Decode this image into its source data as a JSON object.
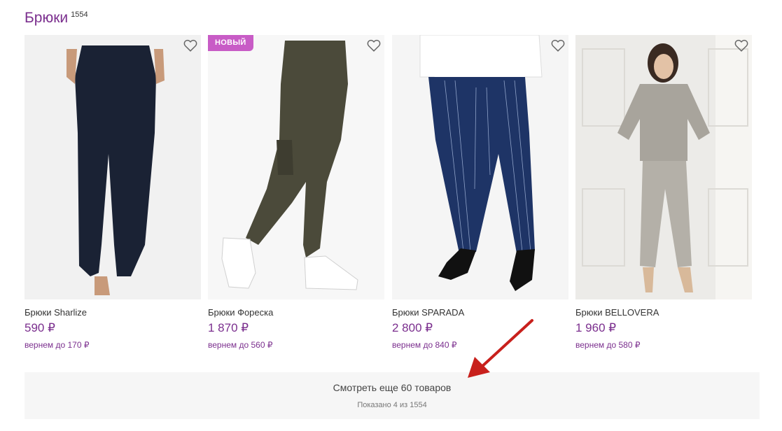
{
  "category": {
    "title": "Брюки",
    "count": "1554"
  },
  "products": [
    {
      "name": "Брюки Sharlize",
      "price": "590 ₽",
      "cashback": "вернем до 170 ₽",
      "badge": ""
    },
    {
      "name": "Брюки Фореска",
      "price": "1 870 ₽",
      "cashback": "вернем до 560 ₽",
      "badge": "НОВЫЙ"
    },
    {
      "name": "Брюки SPARADA",
      "price": "2 800 ₽",
      "cashback": "вернем до 840 ₽",
      "badge": ""
    },
    {
      "name": "Брюки BELLOVERA",
      "price": "1 960 ₽",
      "cashback": "вернем до 580 ₽",
      "badge": ""
    }
  ],
  "load_more": {
    "label": "Смотреть еще 60 товаров",
    "shown": "Показано 4 из 1554"
  },
  "icons": {
    "favorite": "heart-outline-icon",
    "annotation": "red-arrow"
  },
  "colors": {
    "accent": "#7b2f8e",
    "badge": "#c85cc6",
    "arrow": "#c8201c"
  }
}
